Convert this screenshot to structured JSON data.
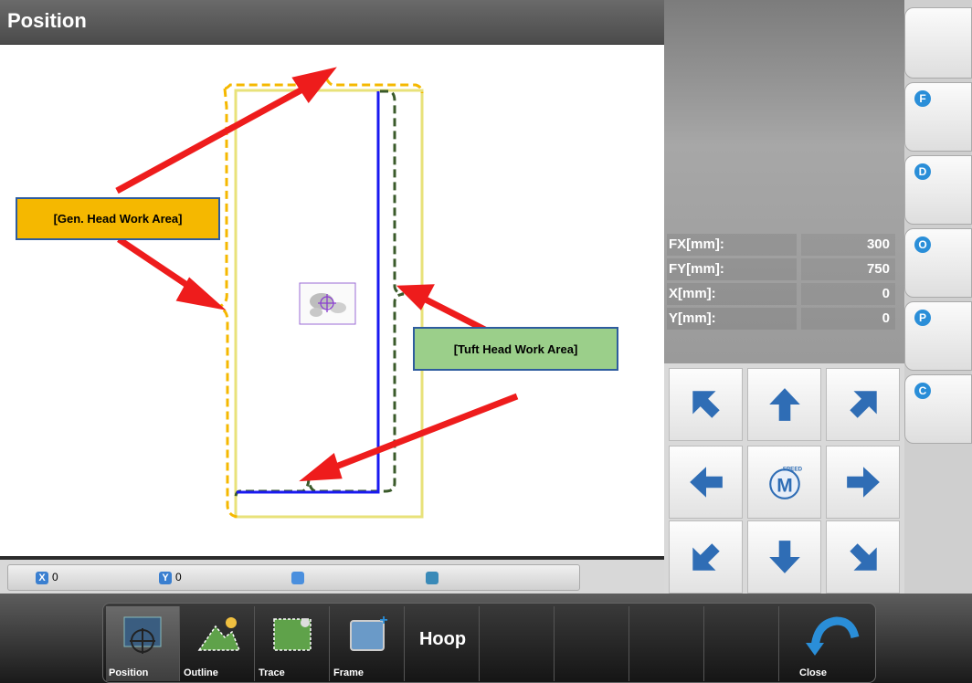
{
  "title": "Position",
  "info": [
    {
      "label": "FX[mm]:",
      "value": "300"
    },
    {
      "label": "FY[mm]:",
      "value": "750"
    },
    {
      "label": "X[mm]:",
      "value": "0"
    },
    {
      "label": "Y[mm]:",
      "value": "0"
    }
  ],
  "tools": [
    {
      "letter": "F",
      "icon": "frame-move-icon"
    },
    {
      "letter": "D",
      "icon": "needle-down-icon"
    },
    {
      "letter": "O",
      "icon": "origin-return-icon"
    },
    {
      "letter": "P",
      "icon": "position-set-icon"
    },
    {
      "letter": "C",
      "icon": "center-icon"
    }
  ],
  "pad": {
    "speed_label": "SPEED",
    "speed_letter": "M"
  },
  "status": {
    "x_icon": "X",
    "x_value": "0",
    "y_icon": "Y",
    "y_value": "0"
  },
  "bottom": {
    "position": "Position",
    "outline": "Outline",
    "trace": "Trace",
    "frame": "Frame",
    "hoop": "Hoop",
    "close": "Close"
  },
  "annotations": {
    "gen_head": "[Gen. Head Work Area]",
    "tuft_head": "[Tuft Head Work Area]",
    "gen_color": "#f5b800",
    "tuft_color": "#9bcf8a"
  }
}
